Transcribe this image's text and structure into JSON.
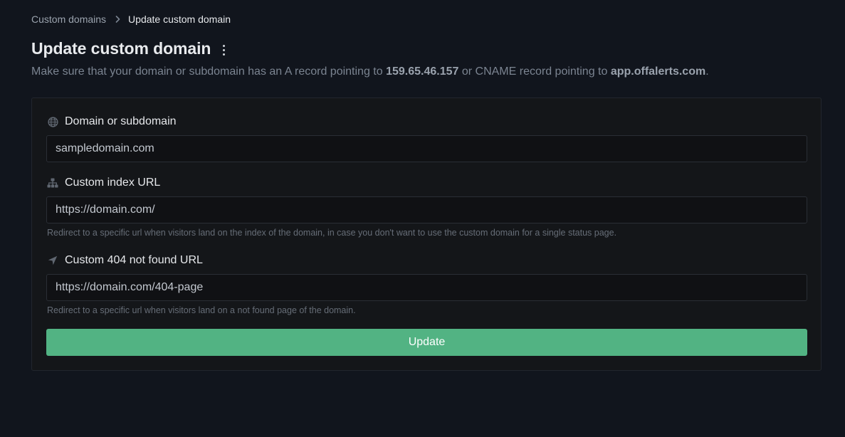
{
  "breadcrumb": {
    "parent": "Custom domains",
    "current": "Update custom domain"
  },
  "header": {
    "title": "Update custom domain",
    "subtitle_prefix": "Make sure that your domain or subdomain has an A record pointing to ",
    "ip": "159.65.46.157",
    "subtitle_middle": " or CNAME record pointing to ",
    "cname": "app.offalerts.com",
    "subtitle_suffix": "."
  },
  "form": {
    "domain": {
      "label": "Domain or subdomain",
      "icon": "globe-icon",
      "value": "sampledomain.com"
    },
    "index_url": {
      "label": "Custom index URL",
      "icon": "sitemap-icon",
      "value": "https://domain.com/",
      "hint": "Redirect to a specific url when visitors land on the index of the domain, in case you don't want to use the custom domain for a single status page."
    },
    "not_found_url": {
      "label": "Custom 404 not found URL",
      "icon": "location-arrow-icon",
      "value": "https://domain.com/404-page",
      "hint": "Redirect to a specific url when visitors land on a not found page of the domain."
    },
    "submit_label": "Update"
  },
  "colors": {
    "background": "#11151d",
    "card": "#141619",
    "accent": "#52b383"
  }
}
